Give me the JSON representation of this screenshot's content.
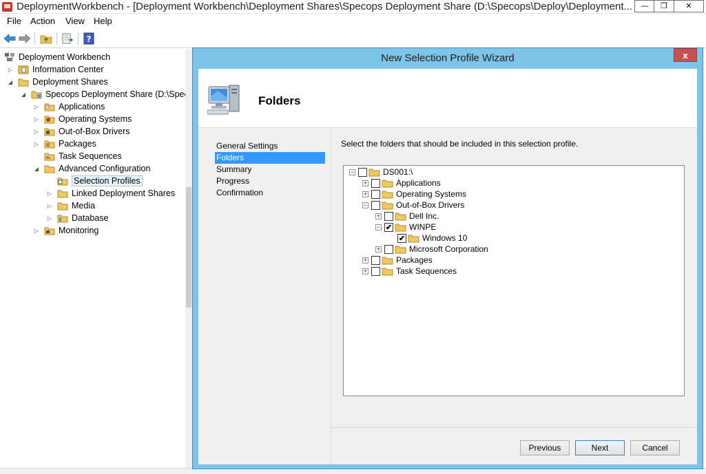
{
  "window": {
    "title": "DeploymentWorkbench - [Deployment Workbench\\Deployment Shares\\Specops Deployment Share (D:\\Specops\\Deploy\\Deployment...",
    "min_glyph": "—",
    "max_glyph": "❐",
    "close_glyph": "✕"
  },
  "menu": [
    "File",
    "Action",
    "View",
    "Help"
  ],
  "toolbar": {
    "icons": [
      "back-arrow-icon",
      "forward-arrow-icon",
      "up-folder-icon",
      "export-list-icon",
      "help-icon"
    ]
  },
  "tree": {
    "items": [
      {
        "label": "Deployment Workbench",
        "level": 0,
        "expander": ""
      },
      {
        "label": "Information Center",
        "level": 1,
        "expander": "▷"
      },
      {
        "label": "Deployment Shares",
        "level": 1,
        "expander": "◢"
      },
      {
        "label": "Specops Deployment Share (D:\\Specops\\",
        "level": 2,
        "expander": "◢"
      },
      {
        "label": "Applications",
        "level": 3,
        "expander": "▷"
      },
      {
        "label": "Operating Systems",
        "level": 3,
        "expander": "▷"
      },
      {
        "label": "Out-of-Box Drivers",
        "level": 3,
        "expander": "▷"
      },
      {
        "label": "Packages",
        "level": 3,
        "expander": "▷"
      },
      {
        "label": "Task Sequences",
        "level": 3,
        "expander": ""
      },
      {
        "label": "Advanced Configuration",
        "level": 3,
        "expander": "◢"
      },
      {
        "label": "Selection Profiles",
        "level": 4,
        "expander": "",
        "selected": true
      },
      {
        "label": "Linked Deployment Shares",
        "level": 4,
        "expander": "▷"
      },
      {
        "label": "Media",
        "level": 4,
        "expander": "▷"
      },
      {
        "label": "Database",
        "level": 4,
        "expander": "▷"
      },
      {
        "label": "Monitoring",
        "level": 3,
        "expander": "▷"
      }
    ]
  },
  "dialog": {
    "title": "New Selection Profile Wizard",
    "close_glyph": "x",
    "heading": "Folders",
    "nav": [
      {
        "label": "General Settings",
        "active": false
      },
      {
        "label": "Folders",
        "active": true
      },
      {
        "label": "Summary",
        "active": false
      },
      {
        "label": "Progress",
        "active": false
      },
      {
        "label": "Confirmation",
        "active": false
      }
    ],
    "instruction": "Select the folders that should be included in this selection profile.",
    "folders": [
      {
        "label": "DS001:\\",
        "level": 0,
        "expander": "−",
        "checked": false
      },
      {
        "label": "Applications",
        "level": 1,
        "expander": "+",
        "checked": false
      },
      {
        "label": "Operating Systems",
        "level": 1,
        "expander": "+",
        "checked": false
      },
      {
        "label": "Out-of-Box Drivers",
        "level": 1,
        "expander": "−",
        "checked": false
      },
      {
        "label": "Dell Inc.",
        "level": 2,
        "expander": "+",
        "checked": false
      },
      {
        "label": "WINPE",
        "level": 2,
        "expander": "−",
        "checked": true
      },
      {
        "label": "Windows 10",
        "level": 3,
        "expander": "",
        "checked": true
      },
      {
        "label": "Microsoft Corporation",
        "level": 2,
        "expander": "+",
        "checked": false
      },
      {
        "label": "Packages",
        "level": 1,
        "expander": "+",
        "checked": false
      },
      {
        "label": "Task Sequences",
        "level": 1,
        "expander": "+",
        "checked": false
      }
    ],
    "buttons": {
      "previous": "Previous",
      "next": "Next",
      "cancel": "Cancel"
    }
  }
}
